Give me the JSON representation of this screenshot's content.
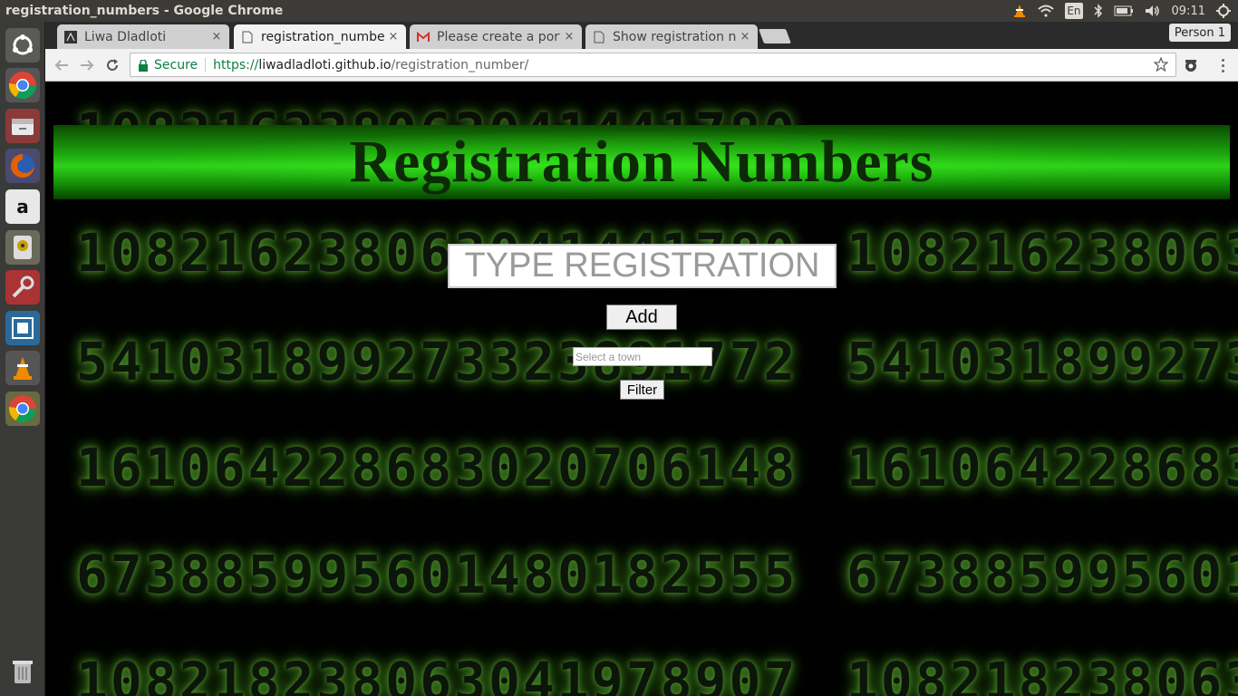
{
  "window": {
    "title": "registration_numbers - Google Chrome"
  },
  "tray": {
    "vlc_icon": "vlc-cone-icon",
    "wifi_icon": "wifi-icon",
    "keyboard_layout": "En",
    "bluetooth_icon": "bluetooth-icon",
    "battery_icon": "battery-icon",
    "volume_icon": "volume-icon",
    "clock": "09:11",
    "session_icon": "gear-icon"
  },
  "launcher": {
    "items": [
      {
        "name": "ubuntu-dash-icon"
      },
      {
        "name": "chrome-icon"
      },
      {
        "name": "files-icon"
      },
      {
        "name": "firefox-icon"
      },
      {
        "name": "amazon-icon"
      },
      {
        "name": "disk-icon"
      },
      {
        "name": "system-settings-icon"
      },
      {
        "name": "workspace-switcher-icon"
      },
      {
        "name": "vlc-icon"
      },
      {
        "name": "chrome-running-icon"
      },
      {
        "name": "trash-icon"
      }
    ],
    "amazon_glyph": "a"
  },
  "tabs": [
    {
      "label": "Liwa Dladloti",
      "icon": "github-favicon-icon",
      "close": "×"
    },
    {
      "label": "registration_numbers",
      "icon": "page-icon",
      "close": "×",
      "active": true
    },
    {
      "label": "Please create a portf",
      "icon": "gmail-icon",
      "close": "×"
    },
    {
      "label": "Show registration nu",
      "icon": "page-icon",
      "close": "×"
    }
  ],
  "profile": {
    "label": "Person 1"
  },
  "omnibox": {
    "secure_label": "Secure",
    "url_scheme": "https://",
    "url_host": "liwadladloti.github.io",
    "url_path": "/registration_number/"
  },
  "page": {
    "title": "Registration Numbers",
    "input_placeholder": "TYPE REGISTRATION",
    "add_label": "Add",
    "select_placeholder": "Select a town",
    "filter_label": "Filter",
    "background_digits": [
      "108216238063041441780",
      "541031899273323891772",
      "161064228683020706148",
      "673885995601480182555",
      "108218238063041978907"
    ]
  },
  "colors": {
    "banner_green": "#2fd11a",
    "secure_green": "#0b8043",
    "page_background": "#000000"
  }
}
